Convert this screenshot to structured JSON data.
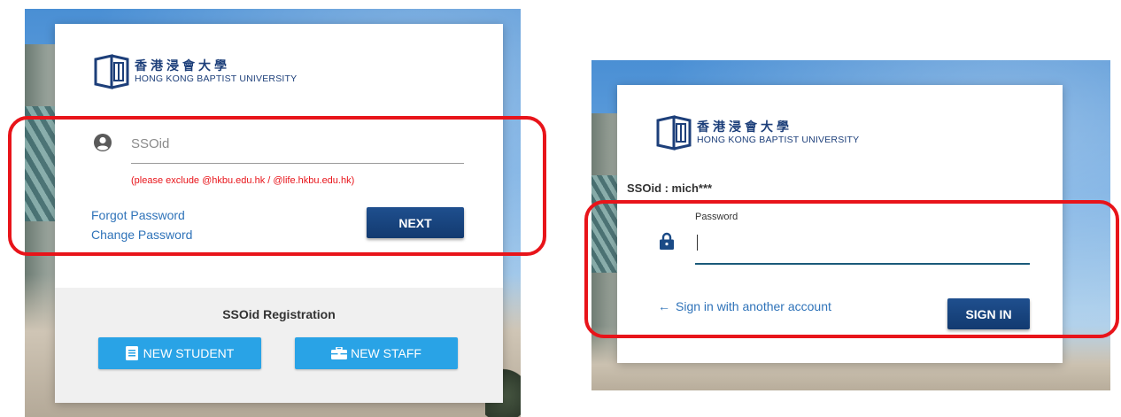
{
  "left": {
    "logo": {
      "chinese": "香港浸會大學",
      "english": "HONG KONG BAPTIST UNIVERSITY"
    },
    "ssoid_field": {
      "placeholder": "SSOid",
      "value": ""
    },
    "hint": "(please exclude @hkbu.edu.hk / @life.hkbu.edu.hk)",
    "forgot_password": "Forgot Password",
    "change_password": "Change Password",
    "next_label": "NEXT",
    "registration": {
      "title": "SSOid Registration",
      "new_student": "NEW STUDENT",
      "new_staff": "NEW STAFF"
    }
  },
  "right": {
    "logo": {
      "chinese": "香港浸會大學",
      "english": "HONG KONG BAPTIST UNIVERSITY"
    },
    "ssoid_label": "SSOid : mich***",
    "password_label": "Password",
    "password_value": "",
    "back_link": "Sign in with another account",
    "signin_label": "SIGN IN"
  },
  "colors": {
    "highlight": "#e8141a",
    "primary": "#1a4a86",
    "accent": "#29a3e6",
    "hint": "#e8141a",
    "link": "#2f73b9"
  }
}
